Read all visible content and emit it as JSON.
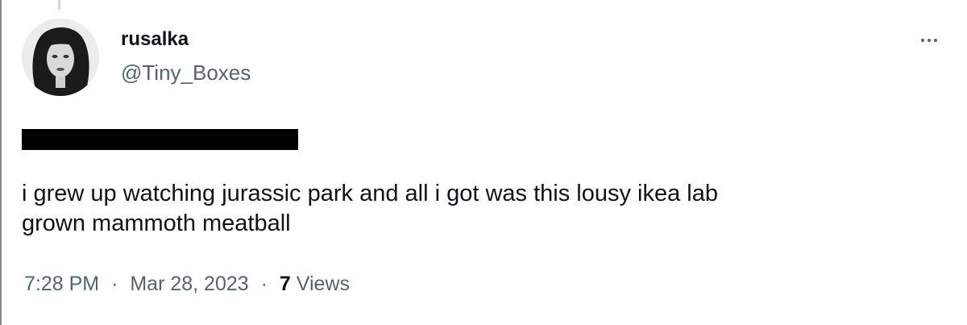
{
  "tweet": {
    "author": {
      "display_name": "rusalka",
      "handle": "@Tiny_Boxes"
    },
    "text_line_1": "i grew up watching jurassic park and all i got was this lousy ikea lab",
    "text_line_2": "grown mammoth meatball",
    "time": "7:28 PM",
    "date": "Mar 28, 2023",
    "separator": "·",
    "views_count": "7",
    "views_label": "Views"
  },
  "icons": {
    "more": "more-horizontal-icon"
  },
  "colors": {
    "text_primary": "#0f1419",
    "text_secondary": "#536471",
    "redaction": "#000000"
  }
}
